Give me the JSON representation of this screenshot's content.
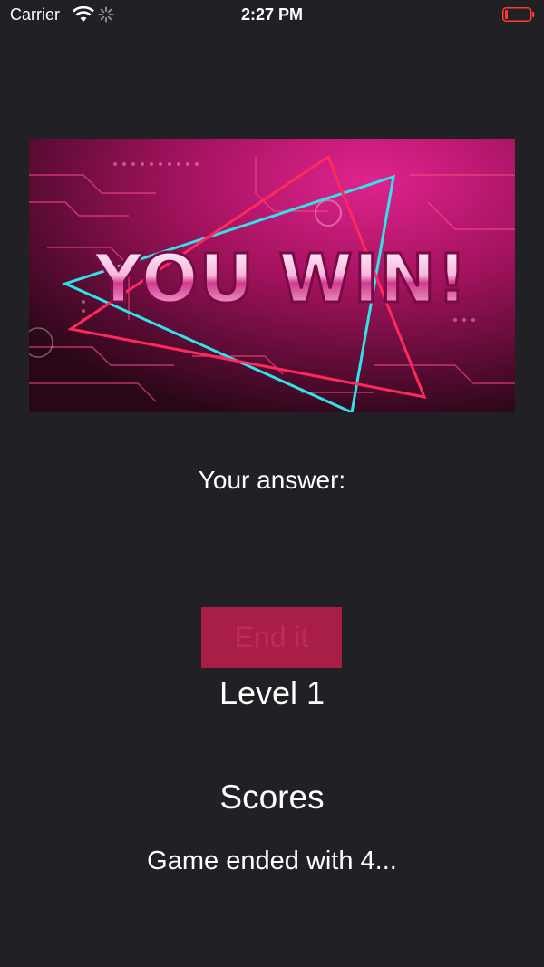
{
  "status_bar": {
    "carrier": "Carrier",
    "time": "2:27 PM",
    "icons": [
      "wifi-icon",
      "activity-icon",
      "battery-icon"
    ],
    "battery_color": "#ff3b30"
  },
  "banner": {
    "headline": "YOU WIN!",
    "colors": {
      "background": "#c2166f",
      "neon_cyan": "#2fe3e8",
      "neon_red": "#ff2a5c",
      "text_fill": "#f4c6e6"
    }
  },
  "game": {
    "answer_label": "Your answer:",
    "end_button_label": "End it",
    "level_label": "Level 1",
    "scores_title": "Scores",
    "scores_text": "Game ended with 4..."
  },
  "theme": {
    "background": "#212125",
    "button_bg": "#a81e47",
    "button_text": "#bd2c55",
    "text": "#ffffff"
  }
}
